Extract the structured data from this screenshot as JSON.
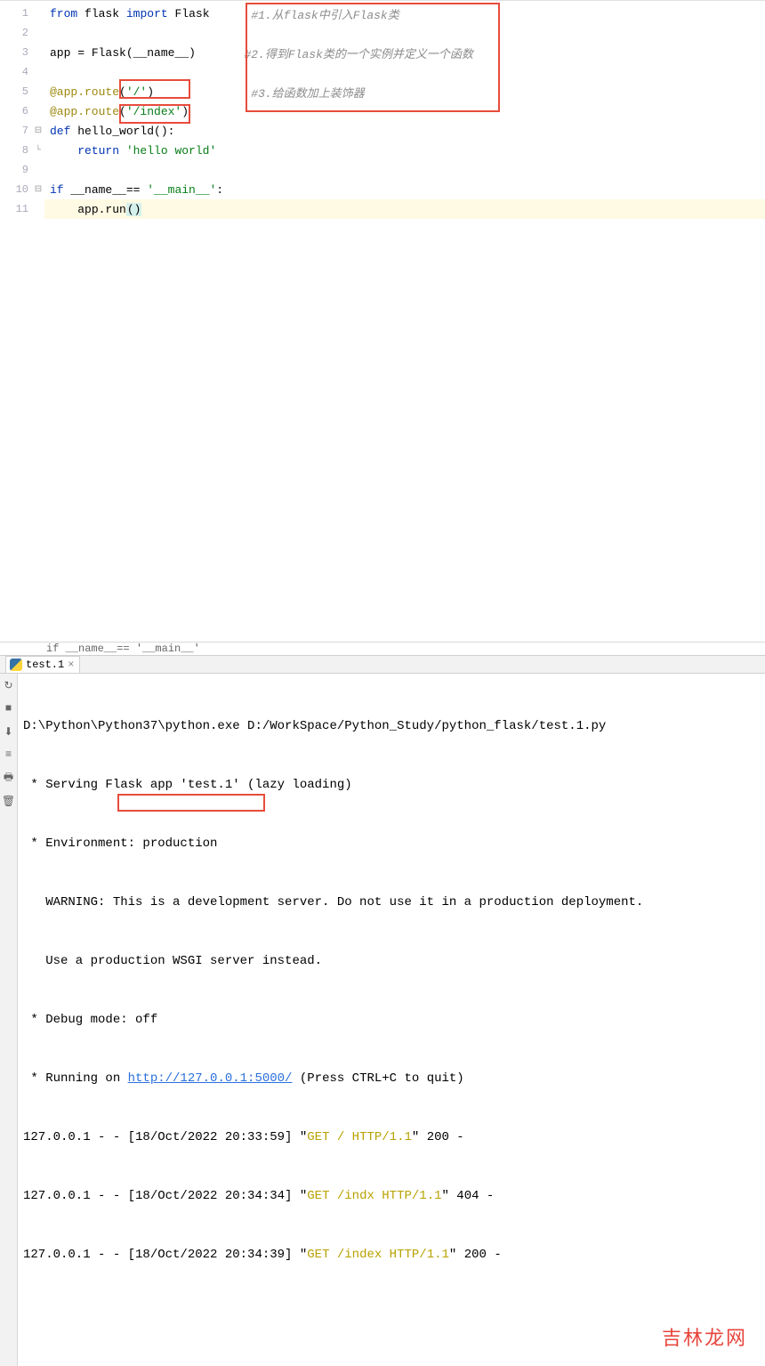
{
  "gutter": [
    "1",
    "2",
    "3",
    "4",
    "5",
    "6",
    "7",
    "8",
    "9",
    "10",
    "11"
  ],
  "code": {
    "l1": {
      "kw_from": "from",
      "mod": "flask",
      "kw_import": "import",
      "cls": "Flask"
    },
    "l3": {
      "var": "app",
      "eq": " = ",
      "cls": "Flask",
      "open": "(",
      "name": "__name__",
      "close": ")"
    },
    "l5": {
      "dec": "@app.route",
      "open": "(",
      "path": "'/'",
      "close": ")"
    },
    "l6": {
      "dec": "@app.route",
      "open": "(",
      "path": "'/index'",
      "close": ")"
    },
    "l7": {
      "kw": "def",
      "fn": " hello_world",
      "sig": "():"
    },
    "l8": {
      "kw": "return",
      "str": " 'hello world'"
    },
    "l10": {
      "kw": "if",
      "cond": " __name__== ",
      "str": "'__main__'",
      "colon": ":"
    },
    "l11": {
      "call": "app.run",
      "paren": "()"
    }
  },
  "comments": {
    "c1": "#1.从flask中引入Flask类",
    "c2": "#2.得到Flask类的一个实例并定义一个函数",
    "c3": "#3.给函数加上装饰器"
  },
  "breadcrumb": "if __name__== '__main__'",
  "tab": {
    "filename": "test.1"
  },
  "console": {
    "line1": "D:\\Python\\Python37\\python.exe D:/WorkSpace/Python_Study/python_flask/test.1.py",
    "line2": " * Serving Flask app 'test.1' (lazy loading)",
    "line3": " * Environment: production",
    "line4": "   WARNING: This is a development server. Do not use it in a production deployment.",
    "line5": "   Use a production WSGI server instead.",
    "line6": " * Debug mode: off",
    "line7a": " * Running on ",
    "line7_url": "http://127.0.0.1:5000/",
    "line7b": " (Press CTRL+C to quit)",
    "log1a": "127.0.0.1 - - [18/Oct/2022 20:33:59] \"",
    "log1b": "GET / HTTP/1.1",
    "log1c": "\" 200 -",
    "log2a": "127.0.0.1 - - [18/Oct/2022 20:34:34] \"",
    "log2b": "GET /indx HTTP/1.1",
    "log2c": "\" 404 -",
    "log3a": "127.0.0.1 - - [18/Oct/2022 20:34:39] \"",
    "log3b": "GET /index HTTP/1.1",
    "log3c": "\" 200 -"
  },
  "watermark": "吉林龙网"
}
